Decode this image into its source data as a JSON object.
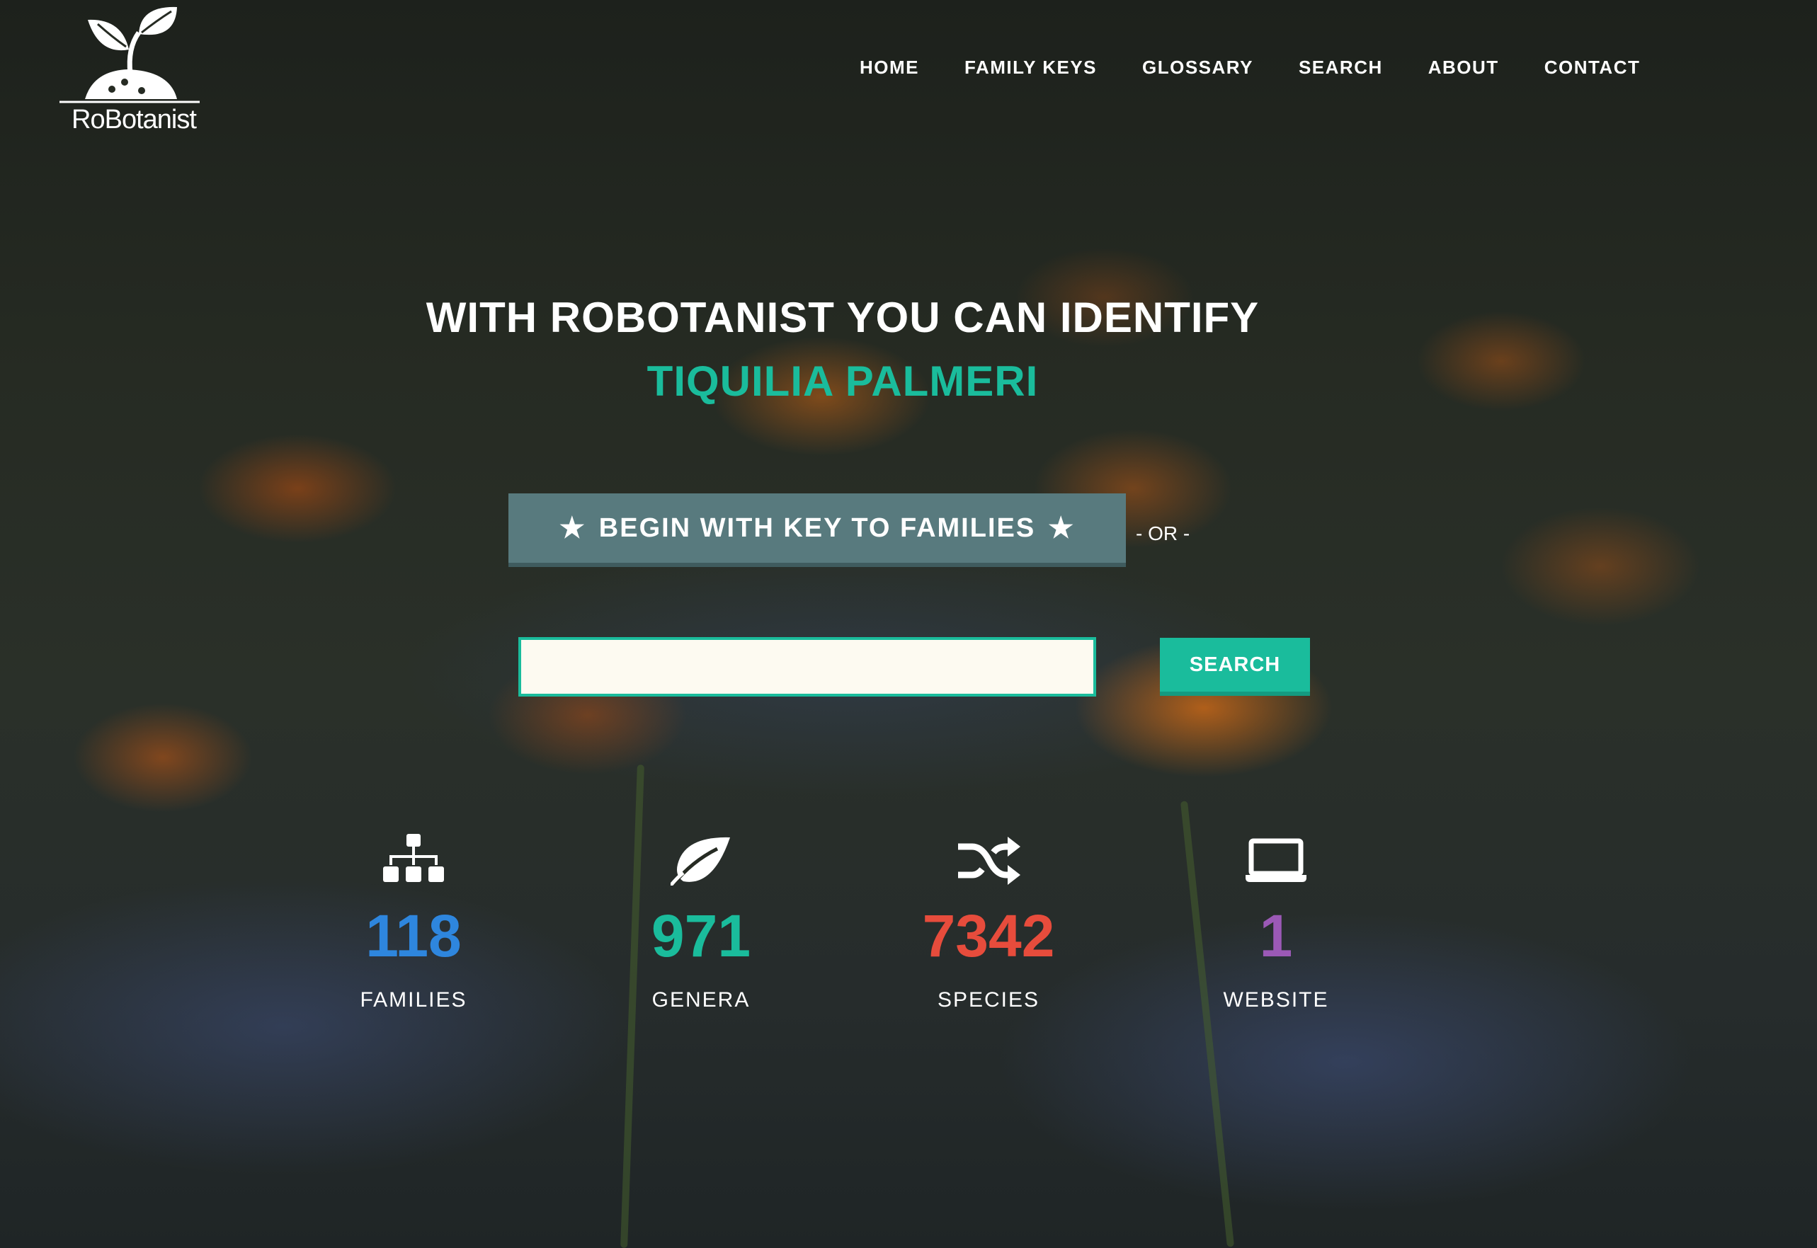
{
  "brand": {
    "name": "RoBotanist"
  },
  "nav": {
    "items": [
      "HOME",
      "FAMILY KEYS",
      "GLOSSARY",
      "SEARCH",
      "ABOUT",
      "CONTACT"
    ]
  },
  "hero": {
    "title": "WITH ROBOTANIST YOU CAN IDENTIFY",
    "subtitle": "TIQUILIA PALMERI",
    "subtitle_color": "#1abc9c"
  },
  "actions": {
    "key_button_label": "BEGIN WITH KEY TO FAMILIES",
    "key_button_icon": "star-icon",
    "or_text": "- OR -",
    "search_value": "",
    "search_placeholder": "",
    "search_button_label": "SEARCH"
  },
  "stats": [
    {
      "icon": "sitemap-icon",
      "number": "118",
      "label": "FAMILIES",
      "color": "#2e86de"
    },
    {
      "icon": "leaf-icon",
      "number": "971",
      "label": "GENERA",
      "color": "#1abc9c"
    },
    {
      "icon": "shuffle-icon",
      "number": "7342",
      "label": "SPECIES",
      "color": "#e74c3c"
    },
    {
      "icon": "laptop-icon",
      "number": "1",
      "label": "WEBSITE",
      "color": "#9b59b6"
    }
  ]
}
